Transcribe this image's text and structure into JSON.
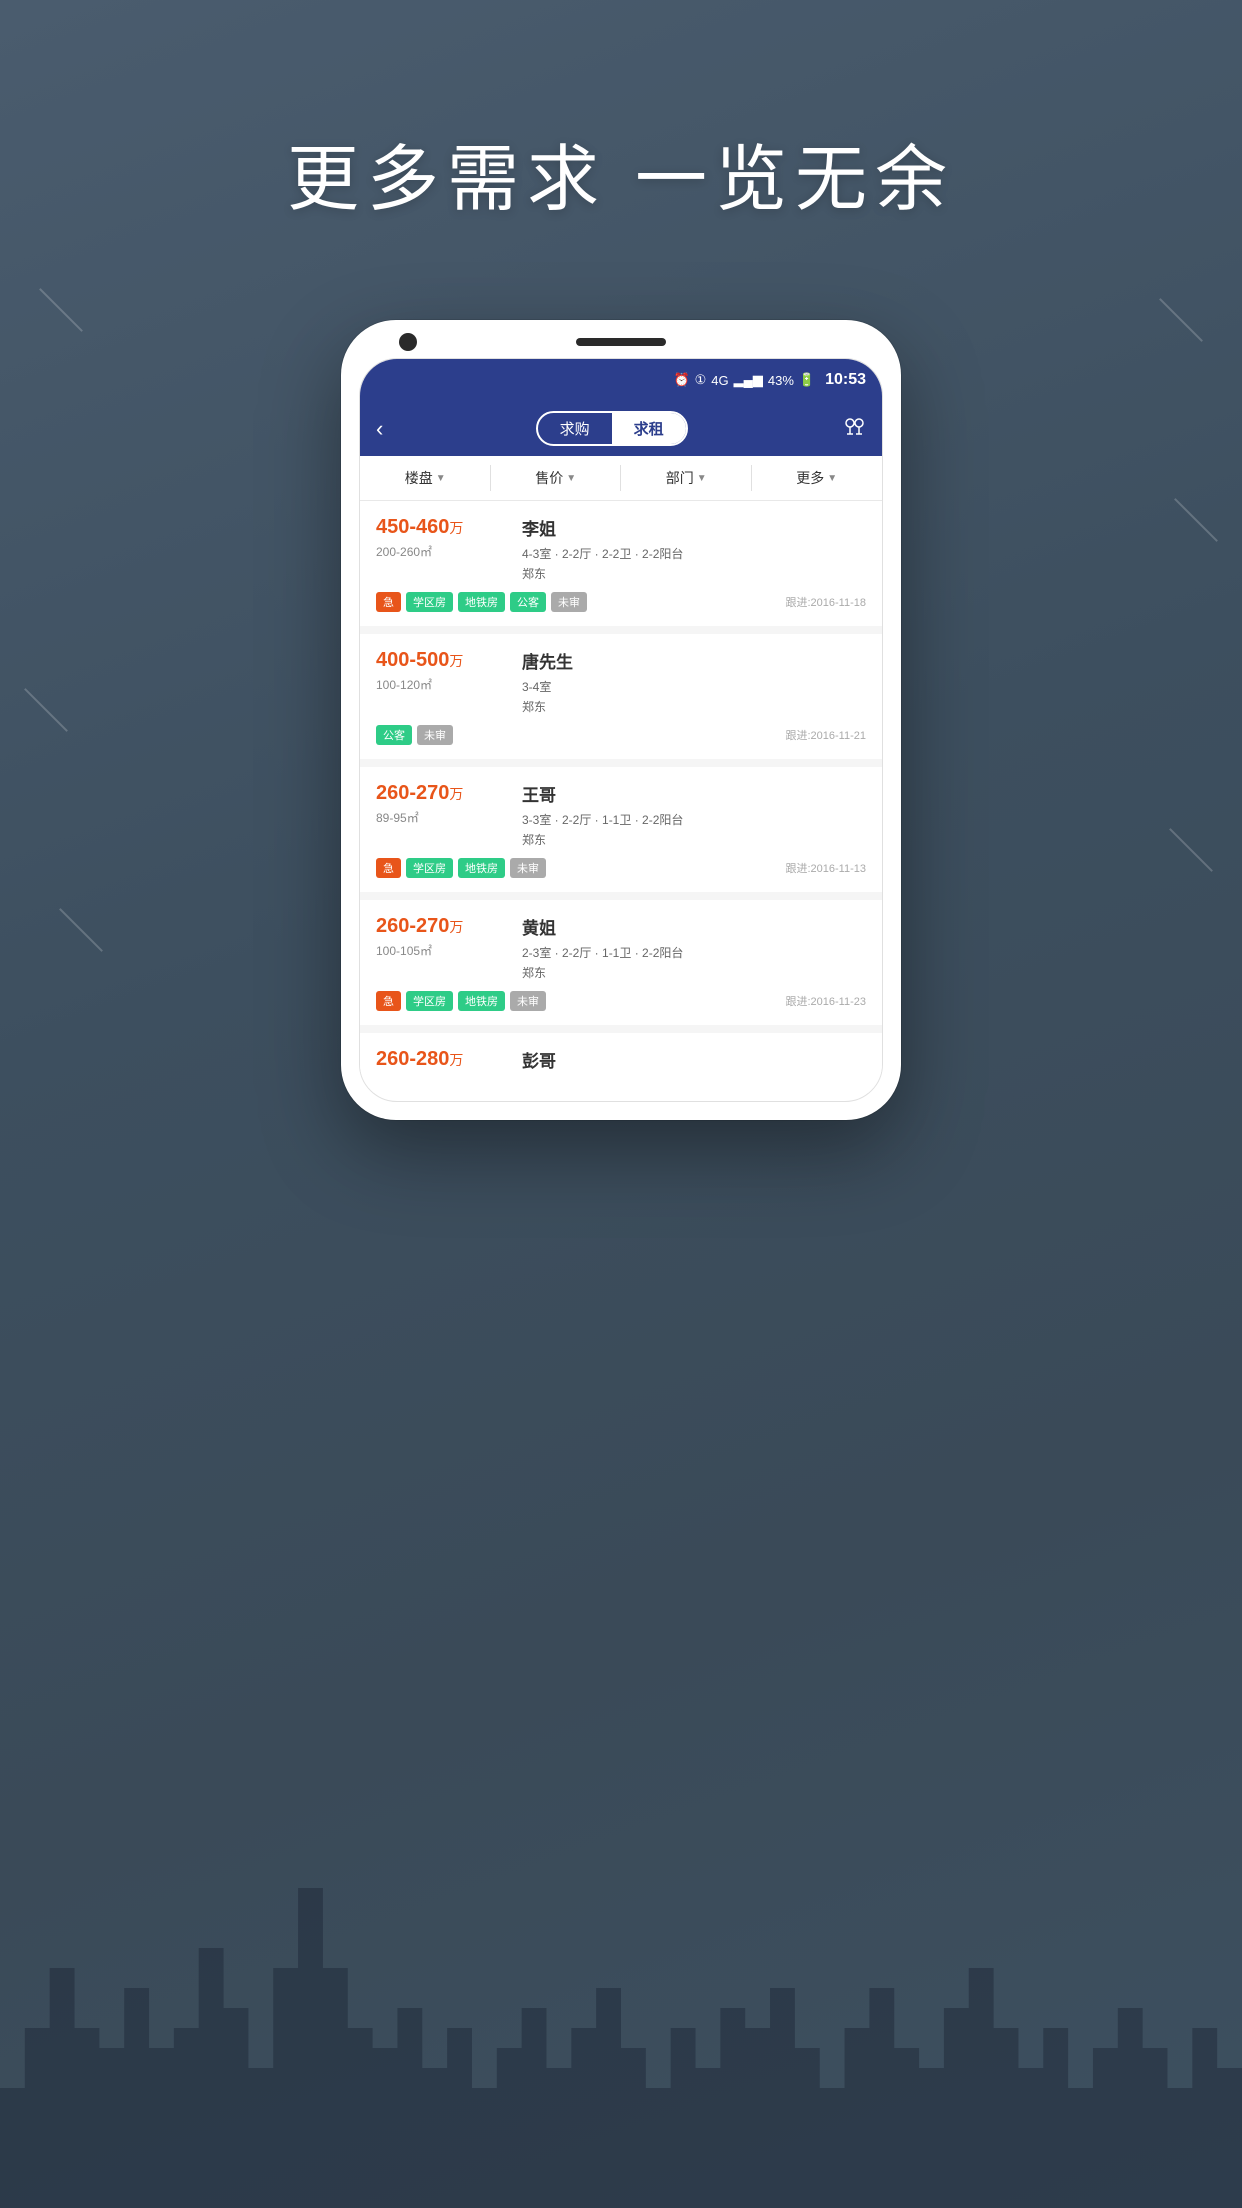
{
  "page": {
    "headline": "更多需求 一览无余",
    "background_color": "#4a5a6b"
  },
  "status_bar": {
    "time": "10:53",
    "battery": "43%",
    "signal_bars": "4G",
    "icons": [
      "alarm",
      "sim",
      "4g",
      "signal",
      "battery"
    ]
  },
  "nav": {
    "back_label": "‹",
    "toggle_option1": "求购",
    "toggle_option2": "求租",
    "toggle_active": "求购",
    "map_icon": "map"
  },
  "filters": [
    {
      "label": "楼盘",
      "has_arrow": true
    },
    {
      "label": "售价",
      "has_arrow": true
    },
    {
      "label": "部门",
      "has_arrow": true
    },
    {
      "label": "更多",
      "has_arrow": true
    }
  ],
  "listings": [
    {
      "id": 1,
      "price": "450-460",
      "price_unit": "万",
      "area": "200-260㎡",
      "name": "李姐",
      "detail": "4-3室 · 2-2厅 · 2-2卫 · 2-2阳台",
      "location": "郑东",
      "tags": [
        {
          "text": "急",
          "type": "urgent"
        },
        {
          "text": "学区房",
          "type": "school"
        },
        {
          "text": "地铁房",
          "type": "metro"
        },
        {
          "text": "公客",
          "type": "public"
        },
        {
          "text": "未审",
          "type": "pending"
        }
      ],
      "follow_date": "跟进:2016-11-18"
    },
    {
      "id": 2,
      "price": "400-500",
      "price_unit": "万",
      "area": "100-120㎡",
      "name": "唐先生",
      "detail": "3-4室",
      "location": "郑东",
      "tags": [
        {
          "text": "公客",
          "type": "public"
        },
        {
          "text": "未审",
          "type": "pending"
        }
      ],
      "follow_date": "跟进:2016-11-21"
    },
    {
      "id": 3,
      "price": "260-270",
      "price_unit": "万",
      "area": "89-95㎡",
      "name": "王哥",
      "detail": "3-3室 · 2-2厅 · 1-1卫 · 2-2阳台",
      "location": "郑东",
      "tags": [
        {
          "text": "急",
          "type": "urgent"
        },
        {
          "text": "学区房",
          "type": "school"
        },
        {
          "text": "地铁房",
          "type": "metro"
        },
        {
          "text": "未审",
          "type": "pending"
        }
      ],
      "follow_date": "跟进:2016-11-13"
    },
    {
      "id": 4,
      "price": "260-270",
      "price_unit": "万",
      "area": "100-105㎡",
      "name": "黄姐",
      "detail": "2-3室 · 2-2厅 · 1-1卫 · 2-2阳台",
      "location": "郑东",
      "tags": [
        {
          "text": "急",
          "type": "urgent"
        },
        {
          "text": "学区房",
          "type": "school"
        },
        {
          "text": "地铁房",
          "type": "metro"
        },
        {
          "text": "未审",
          "type": "pending"
        }
      ],
      "follow_date": "跟进:2016-11-23"
    },
    {
      "id": 5,
      "price": "260-280",
      "price_unit": "万",
      "area": "",
      "name": "彭哥",
      "detail": "",
      "location": "",
      "tags": [],
      "follow_date": ""
    }
  ]
}
